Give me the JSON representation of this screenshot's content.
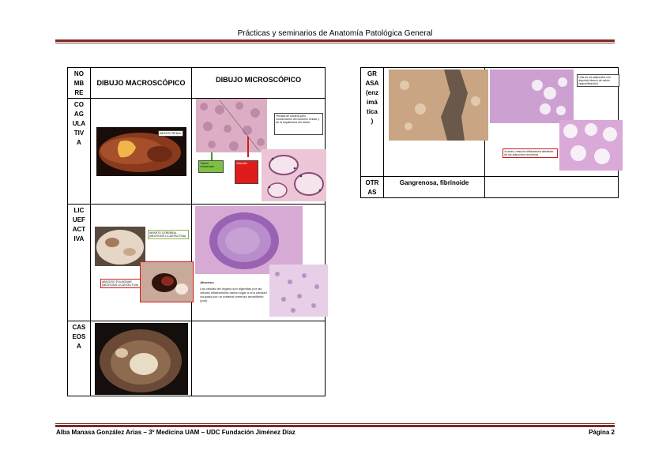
{
  "header": {
    "title": "Prácticas y seminarios de Anatomía Patológica General"
  },
  "footer": {
    "author": "Alba Manasa González Arias – 3º Medicina UAM – UDC Fundación Jiménez Díaz",
    "page": "Página 2"
  },
  "table_left": {
    "col_name": "NO\nMB\nRE",
    "col_macro": "DIBUJO MACROSCÓPICO",
    "col_micro": "DIBUJO MICROSCÓPICO",
    "rows": [
      {
        "name": "CO\nAG\nULA\nTIV\nA",
        "macro_label": "INFARTO RENAL",
        "micro_note": "Pérdida de núcleos pero conservación del contorno celular y de la arquitectura del túbulo",
        "micro_label1": "Túbulo conservado",
        "micro_label2": "Necrosis"
      },
      {
        "name": "LIC\nUEF\nACT\nIVA",
        "macro_label1": "INFARTO CEREBRAL (NECROSIS LICUEFACTIVA)",
        "macro_label2": "ABSCESO PULMONAR (NECROSIS LICUEFACTIVA)",
        "micro_note_title": "Absceso:",
        "micro_note": "Las células del órgano son digeridas por las células inflamatorias dando lugar a una cavidad ocupada por un material cremoso amarillento (pus)"
      },
      {
        "name": "CAS\nEOS\nA"
      }
    ]
  },
  "table_right": {
    "rows": [
      {
        "name": "GR\nASA\n(enz\nimá\ntica\n)",
        "micro_note1": "Lisis de los adipocitos con depósito blanco de calcio (saponificación)",
        "micro_note2": "A veces, reacción inflamatoria alrededor de los adipocitos necróticos"
      },
      {
        "name": "OTR\nAS",
        "text": "Gangrenosa, fibrinoide"
      }
    ]
  }
}
